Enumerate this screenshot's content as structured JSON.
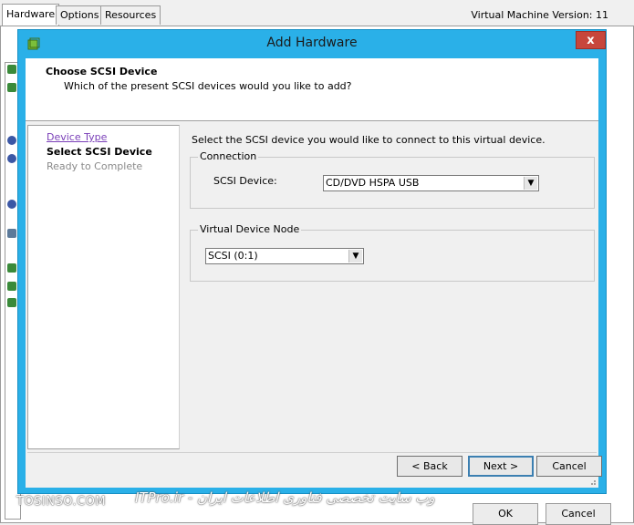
{
  "background_window": {
    "tabs": [
      "Hardware",
      "Options",
      "Resources"
    ],
    "vm_version": "Virtual Machine Version: 11",
    "buttons": {
      "ok": "OK",
      "cancel": "Cancel"
    }
  },
  "dialog": {
    "title": "Add Hardware",
    "close_glyph": "x",
    "header": {
      "title": "Choose SCSI Device",
      "subtitle": "Which of the present SCSI devices would you like to add?"
    },
    "steps": {
      "device_type": "Device Type",
      "select_scsi_device": "Select SCSI Device",
      "ready_to_complete": "Ready to Complete"
    },
    "main": {
      "instructions": "Select the SCSI device you would like to connect to this virtual device.",
      "connection": {
        "label": "Connection",
        "scsi_device_label": "SCSI Device:",
        "scsi_device_value": "CD/DVD HSPA USB"
      },
      "virtual_device_node": {
        "label": "Virtual Device Node",
        "value": "SCSI (0:1)"
      }
    },
    "buttons": {
      "back": "< Back",
      "next": "Next >",
      "cancel": "Cancel"
    }
  },
  "watermarks": {
    "left": "TOSINSO.COM",
    "right": "وب سایت تخصصی فناوری اطلاعات ایران - ITPro.ir"
  },
  "colors": {
    "dialog_frame": "#2ab0e8",
    "close_button": "#c7463c",
    "link": "#7a3fb8"
  }
}
